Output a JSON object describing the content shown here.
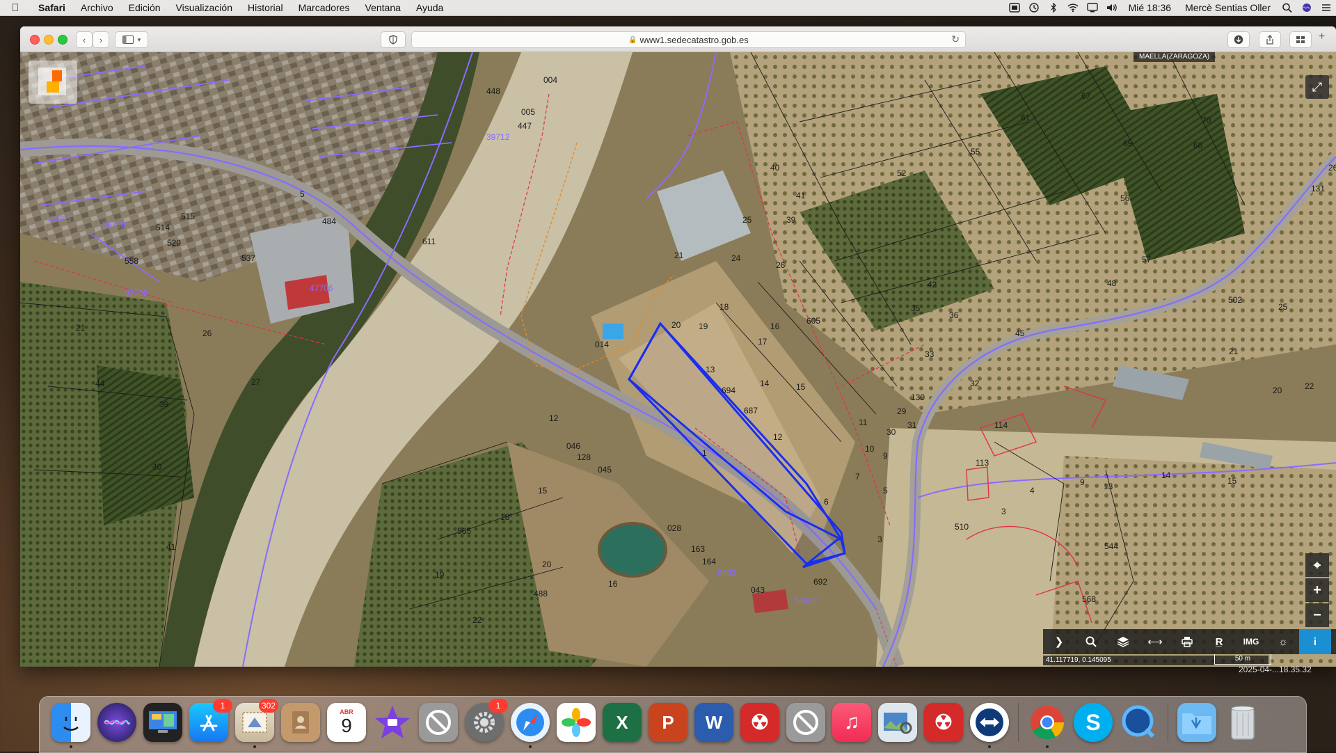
{
  "menubar": {
    "app_name": "Safari",
    "menus": [
      "Archivo",
      "Edición",
      "Visualización",
      "Historial",
      "Marcadores",
      "Ventana",
      "Ayuda"
    ],
    "clock": "Mié 18:36",
    "user": "Mercè Sentias Oller"
  },
  "browser": {
    "url": "www1.sedecatastro.gob.es"
  },
  "map": {
    "municipality": "MAELLA(ZARAGOZA)",
    "coordinates": "41.117719, 0.145095",
    "scale_label": "50 m",
    "parcel_numbers": [
      "448",
      "004",
      "005",
      "447",
      "537",
      "484",
      "514",
      "515",
      "529",
      "558",
      "611",
      "21",
      "20",
      "19",
      "18",
      "014",
      "13",
      "694",
      "687",
      "17",
      "14",
      "15",
      "16",
      "605",
      "1",
      "12",
      "046",
      "128",
      "045",
      "028",
      "163",
      "164",
      "043",
      "5",
      "6",
      "692",
      "18",
      "16",
      "15",
      "488",
      "20",
      "22",
      "565",
      "19",
      "40",
      "41",
      "39",
      "24",
      "25",
      "26",
      "52",
      "55",
      "61",
      "67",
      "69",
      "70",
      "68",
      "56",
      "57",
      "48",
      "45",
      "42",
      "36",
      "38",
      "33",
      "31",
      "32",
      "130",
      "29",
      "30",
      "11",
      "10",
      "9",
      "8",
      "7",
      "502",
      "25",
      "21",
      "20",
      "22",
      "114",
      "113",
      "3",
      "4",
      "510",
      "544",
      "568",
      "4",
      "9",
      "13",
      "15",
      "14",
      "33",
      "26",
      "131"
    ],
    "refs": [
      "39712",
      "02706",
      "47706",
      "44201",
      "35706",
      "0492",
      "04592"
    ]
  },
  "map_tools": [
    "chevron-right",
    "search",
    "layers",
    "measure",
    "print",
    "reference",
    "image",
    "geo",
    "info"
  ],
  "desktop_date": "2025-04-...18.35.32",
  "dock": {
    "calendar_month": "ABR",
    "calendar_day": "9",
    "badges": {
      "appstore": "1",
      "mail": "302",
      "prefs": "1"
    },
    "apps": [
      "Finder",
      "Siri",
      "Activity",
      "App Store",
      "Mail",
      "Contacts",
      "Calendar",
      "iMovie",
      "Disabled",
      "System Preferences",
      "Safari",
      "Photos",
      "Excel",
      "PowerPoint",
      "Word",
      "Acrobat",
      "Disabled 2",
      "Music",
      "Preview",
      "Acrobat Reader",
      "TeamViewer",
      "Chrome",
      "Skype",
      "QuickTime",
      "Downloads",
      "Trash"
    ]
  }
}
